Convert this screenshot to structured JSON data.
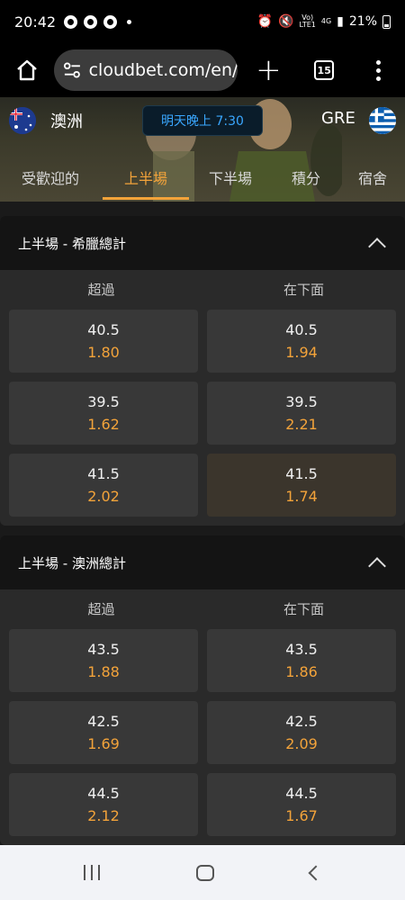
{
  "status_bar": {
    "time": "20:42",
    "battery": "21%",
    "network_top": "VoLTE1",
    "network_4g": "4G"
  },
  "browser": {
    "url": "cloudbet.com/en/",
    "tab_count": "15"
  },
  "match": {
    "home_team": "澳洲",
    "away_team": "GRE",
    "time_label": "明天晚上 7:30"
  },
  "tabs": [
    {
      "label": "受歡迎的"
    },
    {
      "label": "上半場"
    },
    {
      "label": "下半場"
    },
    {
      "label": "積分"
    },
    {
      "label": "宿舍"
    }
  ],
  "markets": [
    {
      "title": "上半場 - 希臘總計",
      "col_over": "超過",
      "col_under": "在下面",
      "rows": [
        {
          "over_line": "40.5",
          "over_price": "1.80",
          "under_line": "40.5",
          "under_price": "1.94"
        },
        {
          "over_line": "39.5",
          "over_price": "1.62",
          "under_line": "39.5",
          "under_price": "2.21"
        },
        {
          "over_line": "41.5",
          "over_price": "2.02",
          "under_line": "41.5",
          "under_price": "1.74"
        }
      ]
    },
    {
      "title": "上半場 - 澳洲總計",
      "col_over": "超過",
      "col_under": "在下面",
      "rows": [
        {
          "over_line": "43.5",
          "over_price": "1.88",
          "under_line": "43.5",
          "under_price": "1.86"
        },
        {
          "over_line": "42.5",
          "over_price": "1.69",
          "under_line": "42.5",
          "under_price": "2.09"
        },
        {
          "over_line": "44.5",
          "over_price": "2.12",
          "under_line": "44.5",
          "under_price": "1.67"
        }
      ]
    }
  ],
  "colors": {
    "accent": "#f3a33a",
    "time_badge_text": "#3aa7ff",
    "cell_bg": "#383838"
  }
}
